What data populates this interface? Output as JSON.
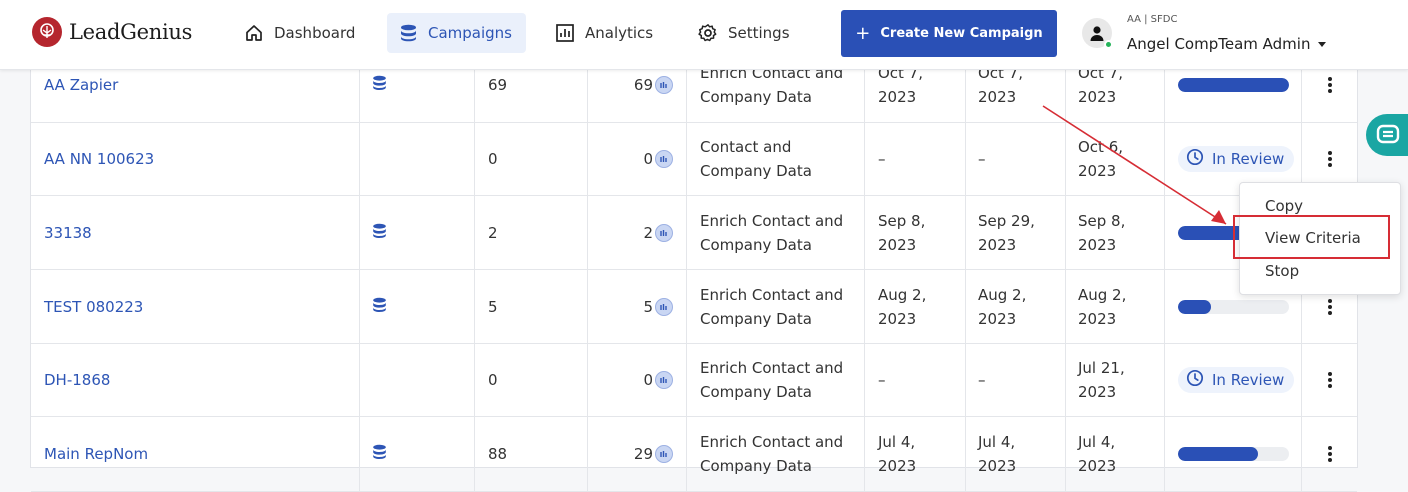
{
  "brand": {
    "name": "LeadGenius"
  },
  "nav": {
    "dashboard": "Dashboard",
    "campaigns": "Campaigns",
    "analytics": "Analytics",
    "settings": "Settings"
  },
  "create_button": {
    "plus": "+",
    "label": "Create New Campaign"
  },
  "user": {
    "org": "AA | SFDC",
    "name": "Angel CompTeam Admin"
  },
  "rows": [
    {
      "name": "AA Zapier",
      "has_db": true,
      "total": "69",
      "enriched": "69",
      "type_l1": "Enrich Contact and",
      "type_l2": "Company Data",
      "d1_l1": "Oct 7,",
      "d1_l2": "2023",
      "d2_l1": "Oct 7,",
      "d2_l2": "2023",
      "d3_l1": "Oct 7,",
      "d3_l2": "2023",
      "status": "progress",
      "progress": 1.0
    },
    {
      "name": "AA NN 100623",
      "has_db": false,
      "total": "0",
      "enriched": "0",
      "type_l1": "Contact and",
      "type_l2": "Company Data",
      "d1_l1": "–",
      "d1_l2": "",
      "d2_l1": "–",
      "d2_l2": "",
      "d3_l1": "Oct 6,",
      "d3_l2": "2023",
      "status": "review",
      "status_label": "In Review"
    },
    {
      "name": "33138",
      "has_db": true,
      "total": "2",
      "enriched": "2",
      "type_l1": "Enrich Contact and",
      "type_l2": "Company Data",
      "d1_l1": "Sep 8,",
      "d1_l2": "2023",
      "d2_l1": "Sep 29,",
      "d2_l2": "2023",
      "d3_l1": "Sep 8,",
      "d3_l2": "2023",
      "status": "progress",
      "progress": 1.0
    },
    {
      "name": "TEST 080223",
      "has_db": true,
      "total": "5",
      "enriched": "5",
      "type_l1": "Enrich Contact and",
      "type_l2": "Company Data",
      "d1_l1": "Aug 2,",
      "d1_l2": "2023",
      "d2_l1": "Aug 2,",
      "d2_l2": "2023",
      "d3_l1": "Aug 2,",
      "d3_l2": "2023",
      "status": "progress",
      "progress": 0.3
    },
    {
      "name": "DH-1868",
      "has_db": false,
      "total": "0",
      "enriched": "0",
      "type_l1": "Enrich Contact and",
      "type_l2": "Company Data",
      "d1_l1": "–",
      "d1_l2": "",
      "d2_l1": "–",
      "d2_l2": "",
      "d3_l1": "Jul 21,",
      "d3_l2": "2023",
      "status": "review",
      "status_label": "In Review"
    },
    {
      "name": "Main RepNom",
      "has_db": true,
      "total": "88",
      "enriched": "29",
      "type_l1": "Enrich Contact and",
      "type_l2": "Company Data",
      "d1_l1": "Jul 4,",
      "d1_l2": "2023",
      "d2_l1": "Jul 4,",
      "d2_l2": "2023",
      "d3_l1": "Jul 4,",
      "d3_l2": "2023",
      "status": "progress",
      "progress": 0.72
    }
  ],
  "menu": {
    "copy": "Copy",
    "view_criteria": "View Criteria",
    "stop": "Stop"
  },
  "colors": {
    "accent": "#2a50b6",
    "brand": "#b5262e",
    "highlight": "#d62d35",
    "chat": "#1aa6a3"
  }
}
